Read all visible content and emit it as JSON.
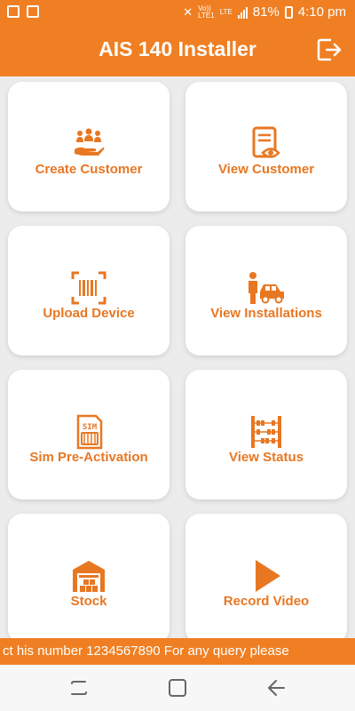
{
  "status_bar": {
    "carrier_top": "Vo))",
    "carrier_bottom": "LTE1",
    "network_top": "LTE",
    "battery": "81%",
    "time": "4:10 pm"
  },
  "app_bar": {
    "title": "AIS 140 Installer"
  },
  "tiles": [
    {
      "label": "Create Customer",
      "icon": "customers-hand-icon"
    },
    {
      "label": "View Customer",
      "icon": "view-document-icon"
    },
    {
      "label": "Upload Device",
      "icon": "barcode-scan-icon"
    },
    {
      "label": "View Installations",
      "icon": "person-car-icon"
    },
    {
      "label": "Sim Pre-Activation",
      "icon": "sim-card-icon"
    },
    {
      "label": "View Status",
      "icon": "abacus-icon"
    },
    {
      "label": "Stock",
      "icon": "warehouse-icon"
    },
    {
      "label": "Record Video",
      "icon": "play-icon"
    }
  ],
  "ticker": {
    "text": "ct his number 1234567890 For any query please"
  },
  "colors": {
    "accent": "#ef7f22",
    "label": "#e87722",
    "background": "#ececec"
  }
}
